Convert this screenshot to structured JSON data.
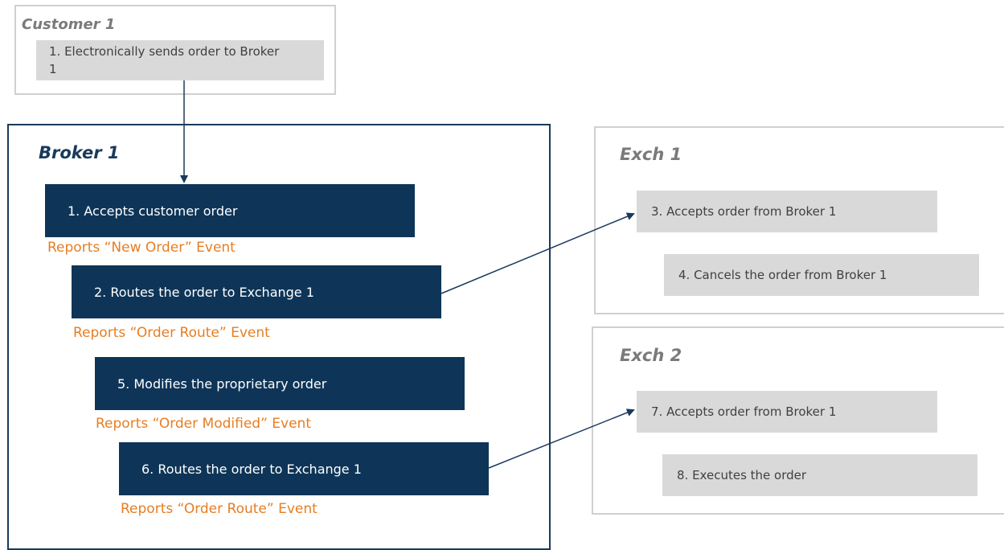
{
  "customer": {
    "title": "Customer 1",
    "step1": "1. Electronically sends order to Broker 1"
  },
  "broker": {
    "title": "Broker 1",
    "steps": [
      {
        "label": "1. Accepts customer order",
        "event": "Reports “New Order” Event"
      },
      {
        "label": "2. Routes the order to Exchange 1",
        "event": "Reports “Order Route” Event"
      },
      {
        "label": "5. Modifies the proprietary order",
        "event": "Reports “Order Modified” Event"
      },
      {
        "label": "6. Routes the order to Exchange 1",
        "event": "Reports “Order Route” Event"
      }
    ]
  },
  "exch1": {
    "title": "Exch 1",
    "steps": [
      "3. Accepts order from Broker 1",
      "4. Cancels the order from Broker 1"
    ]
  },
  "exch2": {
    "title": "Exch 2",
    "steps": [
      "7. Accepts order from Broker 1",
      "8. Executes the order"
    ]
  },
  "colors": {
    "navy": "#0e3558",
    "frame_dark": "#1a3a5c",
    "frame_light": "#d0d0d0",
    "gray_box": "#d9d9d9",
    "event_text": "#e67e22",
    "title_light": "#7a7a7a"
  }
}
